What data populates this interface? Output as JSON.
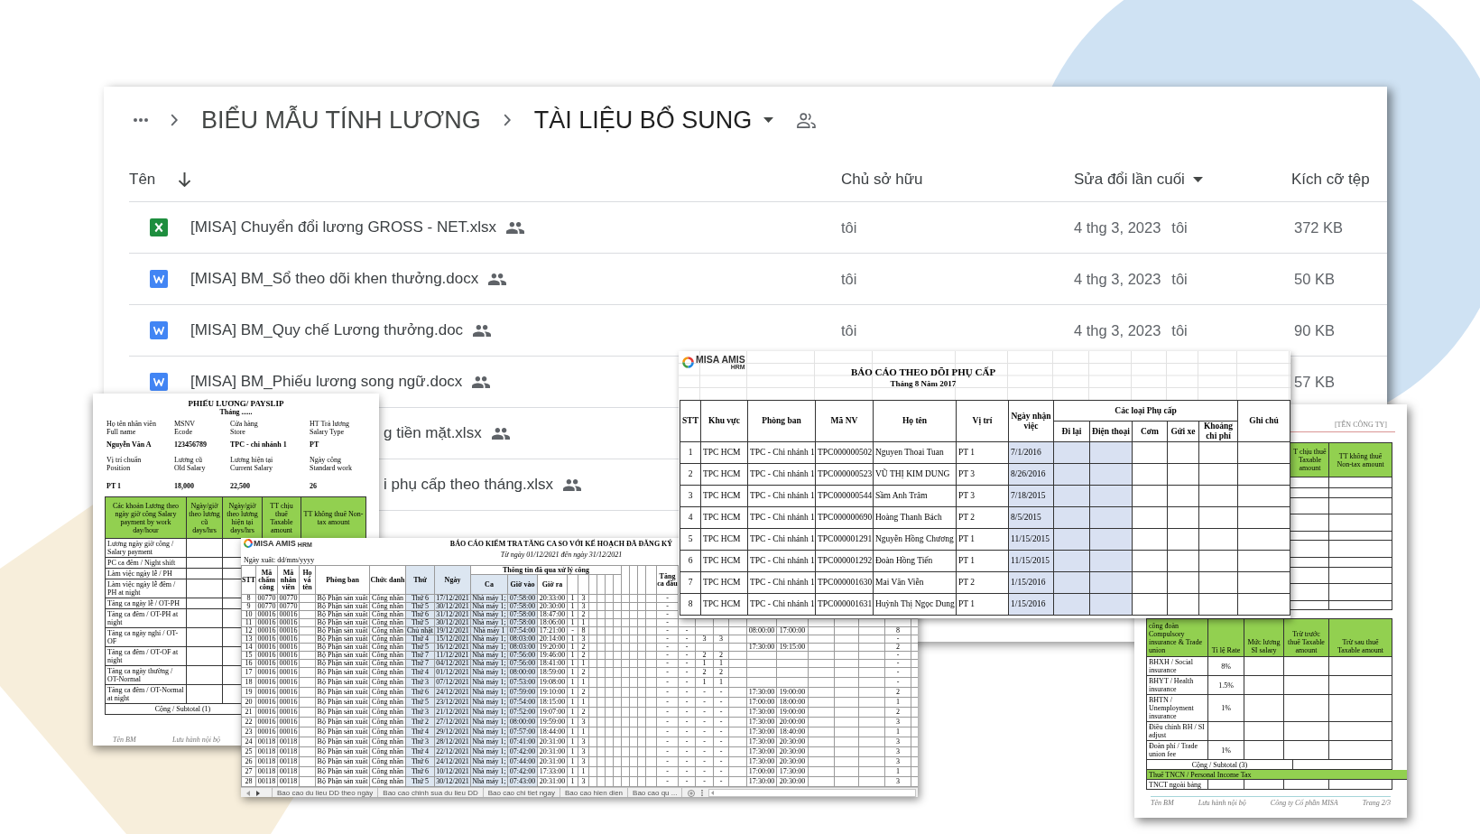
{
  "drive": {
    "breadcrumb": [
      {
        "label": "BIỂU MẪU TÍNH LƯƠNG",
        "current": false,
        "shared": false
      },
      {
        "label": "TÀI LIỆU BỔ SUNG",
        "current": true,
        "shared": true
      }
    ],
    "columns": [
      {
        "label": "Tên",
        "kind": "sorted"
      },
      {
        "label": "Chủ sở hữu",
        "kind": "plain"
      },
      {
        "label": "Sửa đổi lần cuối",
        "kind": "menu"
      },
      {
        "label": "Kích cỡ tệp",
        "kind": "plain"
      }
    ],
    "files": [
      {
        "kind": "spreadsheet",
        "name": "[MISA] Chuyển đổi lương GROSS - NET.xlsx",
        "shared": true,
        "owner": "tôi",
        "modified": "4 thg 3, 2023",
        "modified_by": "tôi",
        "size": "372 KB"
      },
      {
        "kind": "document",
        "name": "[MISA] BM_Sổ theo dõi khen thưởng.docx",
        "shared": true,
        "owner": "tôi",
        "modified": "4 thg 3, 2023",
        "modified_by": "tôi",
        "size": "50 KB"
      },
      {
        "kind": "document",
        "name": "[MISA] BM_Quy chế Lương thưởng.doc",
        "shared": true,
        "owner": "tôi",
        "modified": "4 thg 3, 2023",
        "modified_by": "tôi",
        "size": "90 KB"
      },
      {
        "kind": "document",
        "name": "[MISA] BM_Phiếu lương song ngữ.docx",
        "shared": true,
        "size": "57 KB"
      },
      {
        "kind": "covered",
        "name": "g tiền mặt.xlsx",
        "shared": true
      },
      {
        "kind": "covered",
        "name": "i phụ cấp theo tháng.xlsx",
        "shared": true
      }
    ]
  },
  "allowance_report": {
    "logo": "MISA AMIS",
    "logo_suffix": "HRM",
    "title": "BÁO CÁO THEO DÕI PHỤ CẤP",
    "subtitle": "Tháng 8 Năm 2017",
    "column_group": "Các loại Phụ cấp",
    "columns": [
      {
        "label": "STT",
        "grouped": false,
        "shaded": false
      },
      {
        "label": "Khu vực",
        "grouped": false,
        "shaded": false
      },
      {
        "label": "Phòng ban",
        "grouped": false,
        "shaded": false
      },
      {
        "label": "Mã NV",
        "grouped": false,
        "shaded": false
      },
      {
        "label": "Họ tên",
        "grouped": false,
        "shaded": false
      },
      {
        "label": "Vị trí",
        "grouped": false,
        "shaded": false
      },
      {
        "label": "Ngày nhận việc",
        "grouped": false,
        "shaded": true
      },
      {
        "label": "Đi lại",
        "grouped": true,
        "shaded": true
      },
      {
        "label": "Điện thoại",
        "grouped": true,
        "shaded": true
      },
      {
        "label": "Cơm",
        "grouped": true,
        "shaded": false
      },
      {
        "label": "Gửi xe",
        "grouped": true,
        "shaded": false
      },
      {
        "label": "Khoáng chi phí",
        "grouped": true,
        "shaded": false
      },
      {
        "label": "Ghi chú",
        "grouped": false,
        "shaded": false
      }
    ],
    "rows": [
      [
        "1",
        "TPC HCM",
        "TPC - Chi nhánh 1",
        "TPC000000502",
        "Nguyen Thoai Tuan",
        "PT 1",
        "7/1/2016"
      ],
      [
        "2",
        "TPC HCM",
        "TPC - Chi nhánh 1",
        "TPC000000523",
        "VŨ THỊ KIM DUNG",
        "PT 3",
        "8/26/2016"
      ],
      [
        "3",
        "TPC HCM",
        "TPC - Chi nhánh 1",
        "TPC000000544",
        "Sầm Anh Trâm",
        "PT 3",
        "7/18/2015"
      ],
      [
        "4",
        "TPC HCM",
        "TPC - Chi nhánh 1",
        "TPC000000690",
        "Hoàng Thanh Bách",
        "PT 2",
        "8/5/2015"
      ],
      [
        "5",
        "TPC HCM",
        "TPC - Chi nhánh 1",
        "TPC000001291",
        "Nguyễn Hồng Chương",
        "PT 1",
        "11/15/2015"
      ],
      [
        "6",
        "TPC HCM",
        "TPC - Chi nhánh 1",
        "TPC000001292",
        "Đoàn Hồng Tiến",
        "PT 1",
        "11/15/2015"
      ],
      [
        "7",
        "TPC HCM",
        "TPC - Chi nhánh 1",
        "TPC000001630",
        "Mai Văn Viễn",
        "PT 2",
        "1/15/2016"
      ],
      [
        "8",
        "TPC HCM",
        "TPC - Chi nhánh 1",
        "TPC000001631",
        "Huỳnh Thị Ngọc Dung",
        "PT 1",
        "1/15/2016"
      ]
    ]
  },
  "payslip": {
    "title": "PHIẾU LƯƠNG/ PAYSLIP",
    "period": "Tháng ......",
    "fields": [
      {
        "label": "Họ tên nhân viên",
        "label_en": "Full name",
        "value": "Nguyễn Văn A"
      },
      {
        "label": "MSNV",
        "label_en": "Ecode",
        "value": "123456789"
      },
      {
        "label": "Cửa hàng",
        "label_en": "Store",
        "value": "TPC - chi nhánh 1"
      },
      {
        "label": "HT Trả lương",
        "label_en": "Salary Type",
        "value": "PT"
      },
      {
        "label": "Vị trí chuẩn",
        "label_en": "Position",
        "value": "PT 1"
      },
      {
        "label": "Lương cũ",
        "label_en": "Old Salary",
        "value": "18,000"
      },
      {
        "label": "Lương hiện tại",
        "label_en": "Current Salary",
        "value": "22,500"
      },
      {
        "label": "Ngày công",
        "label_en": "Standard work",
        "value": "26"
      }
    ],
    "columns": [
      "Các khoản Lương theo ngày giờ công Salary payment by work day/hour",
      "Ngày/giờ theo lương cũ days/hrs",
      "Ngày/giờ theo lương hiện tại days/hrs",
      "TT chịu thuế Taxable amount",
      "TT không thuế Non-tax amount"
    ],
    "rows": [
      "Lương ngày giờ công / Salary payment",
      "PC ca đêm / Night shift",
      "Làm việc ngày lễ / PH",
      "Làm việc ngày lễ đêm / PH at night",
      "Tăng ca ngày lễ / OT-PH",
      "Tăng ca đêm / OT-PH at night",
      "Tăng ca ngày nghỉ / OT-OF",
      "Tăng ca đêm / OT-OF at night",
      "Tăng ca ngày thường / OT-Normal",
      "Tăng ca đêm / OT-Normal at night"
    ],
    "subtotal": "Cộng / Subtotal (1)",
    "footer": [
      "Tên BM",
      "Lưu hành nội bộ"
    ]
  },
  "overtime_report": {
    "logo": "MISA AMIS",
    "logo_suffix": "HRM",
    "title": "BÁO CÁO KIỂM TRA TĂNG CA SO VỚI KẾ HOẠCH ĐÃ ĐĂNG KÝ",
    "date_range": "Từ ngày 01/12/2021 đến ngày 31/12/2021",
    "export_date": "Ngày xuất: dd/mm/yyyy",
    "column_group": "Thông tin đã qua xử lý công",
    "columns": {
      "stt": {
        "label": "STT",
        "shaded": false
      },
      "attendance_code": {
        "label": "Mã chấm công",
        "shaded": false
      },
      "employee_code": {
        "label": "Mã nhân viên",
        "shaded": false
      },
      "full_name": {
        "label": "Họ và tên",
        "shaded": false
      },
      "department": {
        "label": "Phòng ban",
        "shaded": false
      },
      "job_title": {
        "label": "Chức danh",
        "shaded": false
      },
      "weekday": {
        "label": "Thứ",
        "shaded": true
      },
      "date": {
        "label": "Ngày",
        "shaded": true
      },
      "shift": {
        "label": "Ca",
        "shaded": true
      },
      "time_in": {
        "label": "Giờ vào",
        "shaded": true
      },
      "time_out": {
        "label": "Giờ ra",
        "shaded": false
      },
      "overtime_start": {
        "label": "Tăng ca đầu",
        "shaded": false
      }
    },
    "rows": [
      {
        "compact": true,
        "stt": "8",
        "attendance_code": "00770",
        "employee_code": "00770",
        "department": "Bộ Phận sản xuất",
        "job_title": "Công nhân",
        "weekday": "Thứ 6",
        "date": "17/12/2021",
        "shift": "Nhà máy 1;",
        "time_in": "07:58:00",
        "time_out": "20:33:00",
        "column_12": "1",
        "column_13": "3",
        "overtime_start": "-"
      },
      {
        "compact": true,
        "stt": "9",
        "attendance_code": "00770",
        "employee_code": "00770",
        "department": "Bộ Phận sản xuất",
        "job_title": "Công nhân",
        "weekday": "Thứ 5",
        "date": "30/12/2021",
        "shift": "Nhà máy 1;",
        "time_in": "07:58:00",
        "time_out": "20:30:00",
        "column_12": "1",
        "column_13": "3",
        "overtime_start": "-"
      },
      {
        "compact": true,
        "stt": "10",
        "attendance_code": "00016",
        "employee_code": "00016",
        "department": "Bộ Phận sản xuất",
        "job_title": "Công nhân",
        "weekday": "Thứ 6",
        "date": "31/12/2021",
        "shift": "Nhà máy 1;",
        "time_in": "07:58:00",
        "time_out": "18:47:00",
        "column_12": "1",
        "column_13": "2",
        "overtime_start": "-"
      },
      {
        "compact": true,
        "stt": "11",
        "attendance_code": "00016",
        "employee_code": "00016",
        "department": "Bộ Phận sản xuất",
        "job_title": "Công nhân",
        "weekday": "Thứ 5",
        "date": "30/12/2021",
        "shift": "Nhà máy 1;",
        "time_in": "07:58:00",
        "time_out": "18:06:00",
        "column_12": "1",
        "column_13": "1",
        "overtime_start": "-"
      },
      {
        "compact": true,
        "stt": "12",
        "attendance_code": "00016",
        "employee_code": "00016",
        "department": "Bộ Phận sản xuất",
        "job_title": "Công nhân",
        "weekday": "Chủ nhật",
        "date": "19/12/2021",
        "shift": "Nhà máy 1",
        "time_in": "07:54:00",
        "time_out": "17:21:00",
        "column_12": "-",
        "column_13": "8",
        "overtime_start": "-",
        "column_23": "-",
        "column_27": "08:00:00",
        "column_28": "17:00:00",
        "column_32": "8"
      },
      {
        "compact": true,
        "stt": "13",
        "attendance_code": "00016",
        "employee_code": "00016",
        "department": "Bộ Phận sản xuất",
        "job_title": "Công nhân",
        "weekday": "Thứ 4",
        "date": "15/12/2021",
        "shift": "Nhà máy 1;",
        "time_in": "08:03:00",
        "time_out": "20:14:00",
        "column_12": "1",
        "column_13": "3",
        "overtime_start": "-",
        "column_23": "-",
        "column_24": "3",
        "column_25": "3",
        "column_32": "-"
      },
      {
        "compact": true,
        "stt": "14",
        "attendance_code": "00016",
        "employee_code": "00016",
        "department": "Bộ Phận sản xuất",
        "job_title": "Công nhân",
        "weekday": "Thứ 5",
        "date": "16/12/2021",
        "shift": "Nhà máy 1;",
        "time_in": "08:03:00",
        "time_out": "19:20:00",
        "column_12": "1",
        "column_13": "2",
        "overtime_start": "-",
        "column_23": "-",
        "column_27": "17:30:00",
        "column_28": "19:15:00",
        "column_32": "2"
      },
      {
        "compact": true,
        "stt": "15",
        "attendance_code": "00016",
        "employee_code": "00016",
        "department": "Bộ Phận sản xuất",
        "job_title": "Công nhân",
        "weekday": "Thứ 7",
        "date": "11/12/2021",
        "shift": "Nhà máy 1;",
        "time_in": "07:56:00",
        "time_out": "19:46:00",
        "column_12": "1",
        "column_13": "2",
        "overtime_start": "-",
        "column_23": "-",
        "column_24": "2",
        "column_25": "2",
        "column_32": "-"
      },
      {
        "compact": true,
        "stt": "16",
        "attendance_code": "00016",
        "employee_code": "00016",
        "department": "Bộ Phận sản xuất",
        "job_title": "Công nhân",
        "weekday": "Thứ 7",
        "date": "04/12/2021",
        "shift": "Nhà máy 1;",
        "time_in": "07:56:00",
        "time_out": "18:41:00",
        "column_12": "1",
        "column_13": "1",
        "overtime_start": "-",
        "column_23": "-",
        "column_24": "1",
        "column_25": "1",
        "column_32": "-"
      },
      {
        "compact": false,
        "stt": "17",
        "attendance_code": "00016",
        "employee_code": "00016",
        "department": "Bộ Phận sản xuất",
        "job_title": "Công nhân",
        "weekday": "Thứ 4",
        "date": "01/12/2021",
        "shift": "Nhà máy 1;",
        "time_in": "08:00:00",
        "time_out": "18:59:00",
        "column_12": "1",
        "column_13": "2",
        "overtime_start": "-",
        "column_23": "-",
        "column_24": "2",
        "column_25": "2",
        "column_32": "-"
      },
      {
        "compact": false,
        "stt": "18",
        "attendance_code": "00016",
        "employee_code": "00016",
        "department": "Bộ Phận sản xuất",
        "job_title": "Công nhân",
        "weekday": "Thứ 3",
        "date": "07/12/2021",
        "shift": "Nhà máy 1;",
        "time_in": "07:53:00",
        "time_out": "19:08:00",
        "column_12": "1",
        "column_13": "1",
        "overtime_start": "-",
        "column_23": "-",
        "column_24": "1",
        "column_25": "1",
        "column_32": "-"
      },
      {
        "compact": false,
        "stt": "19",
        "attendance_code": "00016",
        "employee_code": "00016",
        "department": "Bộ Phận sản xuất",
        "job_title": "Công nhân",
        "weekday": "Thứ 6",
        "date": "24/12/2021",
        "shift": "Nhà máy 1;",
        "time_in": "07:59:00",
        "time_out": "19:10:00",
        "column_12": "1",
        "column_13": "2",
        "overtime_start": "-",
        "column_23": "-",
        "column_24": "-",
        "column_25": "-",
        "column_27": "17:30:00",
        "column_28": "19:00:00",
        "column_32": "2"
      },
      {
        "compact": false,
        "stt": "20",
        "attendance_code": "00016",
        "employee_code": "00016",
        "department": "Bộ Phận sản xuất",
        "job_title": "Công nhân",
        "weekday": "Thứ 5",
        "date": "23/12/2021",
        "shift": "Nhà máy 1;",
        "time_in": "07:54:00",
        "time_out": "18:15:00",
        "column_12": "1",
        "column_13": "1",
        "overtime_start": "-",
        "column_23": "-",
        "column_24": "-",
        "column_25": "-",
        "column_27": "17:00:00",
        "column_28": "18:00:00",
        "column_32": "1"
      },
      {
        "compact": false,
        "stt": "21",
        "attendance_code": "00016",
        "employee_code": "00016",
        "department": "Bộ Phận sản xuất",
        "job_title": "Công nhân",
        "weekday": "Thứ 3",
        "date": "21/12/2021",
        "shift": "Nhà máy 1;",
        "time_in": "07:52:00",
        "time_out": "19:07:00",
        "column_12": "1",
        "column_13": "2",
        "overtime_start": "-",
        "column_23": "-",
        "column_24": "-",
        "column_25": "-",
        "column_27": "17:30:00",
        "column_28": "19:00:00",
        "column_32": "2"
      },
      {
        "compact": false,
        "stt": "22",
        "attendance_code": "00016",
        "employee_code": "00016",
        "department": "Bộ Phận sản xuất",
        "job_title": "Công nhân",
        "weekday": "Thứ 2",
        "date": "27/12/2021",
        "shift": "Nhà máy 1;",
        "time_in": "08:00:00",
        "time_out": "19:59:00",
        "column_12": "1",
        "column_13": "3",
        "overtime_start": "-",
        "column_23": "-",
        "column_24": "-",
        "column_25": "-",
        "column_27": "17:30:00",
        "column_28": "20:00:00",
        "column_32": "3"
      },
      {
        "compact": false,
        "stt": "23",
        "attendance_code": "00016",
        "employee_code": "00016",
        "department": "Bộ Phận sản xuất",
        "job_title": "Công nhân",
        "weekday": "Thứ 4",
        "date": "29/12/2021",
        "shift": "Nhà máy 1;",
        "time_in": "07:57:00",
        "time_out": "18:44:00",
        "column_12": "1",
        "column_13": "1",
        "overtime_start": "-",
        "column_23": "-",
        "column_24": "-",
        "column_25": "-",
        "column_27": "17:30:00",
        "column_28": "18:40:00",
        "column_32": "1"
      },
      {
        "compact": false,
        "stt": "24",
        "attendance_code": "00118",
        "employee_code": "00118",
        "department": "Bộ Phận sản xuất",
        "job_title": "Công nhân",
        "weekday": "Thứ 3",
        "date": "28/12/2021",
        "shift": "Nhà máy 1;",
        "time_in": "07:41:00",
        "time_out": "20:31:00",
        "column_12": "1",
        "column_13": "3",
        "overtime_start": "-",
        "column_23": "-",
        "column_24": "-",
        "column_25": "-",
        "column_27": "17:30:00",
        "column_28": "20:30:00",
        "column_32": "3"
      },
      {
        "compact": false,
        "stt": "25",
        "attendance_code": "00118",
        "employee_code": "00118",
        "department": "Bộ Phận sản xuất",
        "job_title": "Công nhân",
        "weekday": "Thứ 4",
        "date": "22/12/2021",
        "shift": "Nhà máy 1;",
        "time_in": "07:42:00",
        "time_out": "20:31:00",
        "column_12": "1",
        "column_13": "3",
        "overtime_start": "-",
        "column_23": "-",
        "column_24": "-",
        "column_25": "-",
        "column_27": "17:30:00",
        "column_28": "20:30:00",
        "column_32": "3"
      },
      {
        "compact": false,
        "stt": "26",
        "attendance_code": "00118",
        "employee_code": "00118",
        "department": "Bộ Phận sản xuất",
        "job_title": "Công nhân",
        "weekday": "Thứ 6",
        "date": "24/12/2021",
        "shift": "Nhà máy 1;",
        "time_in": "07:44:00",
        "time_out": "20:31:00",
        "column_12": "1",
        "column_13": "3",
        "overtime_start": "-",
        "column_23": "-",
        "column_24": "-",
        "column_25": "-",
        "column_27": "17:30:00",
        "column_28": "20:30:00",
        "column_32": "3"
      },
      {
        "compact": false,
        "stt": "27",
        "attendance_code": "00118",
        "employee_code": "00118",
        "department": "Bộ Phận sản xuất",
        "job_title": "Công nhân",
        "weekday": "Thứ 6",
        "date": "10/12/2021",
        "shift": "Nhà máy 1;",
        "time_in": "07:42:00",
        "time_out": "17:33:00",
        "column_12": "1",
        "column_13": "1",
        "overtime_start": "-",
        "column_23": "-",
        "column_24": "-",
        "column_25": "-",
        "column_27": "17:00:00",
        "column_28": "17:30:00",
        "column_32": "1"
      },
      {
        "compact": false,
        "stt": "28",
        "attendance_code": "00118",
        "employee_code": "00118",
        "department": "Bộ Phận sản xuất",
        "job_title": "Công nhân",
        "weekday": "Thứ 5",
        "date": "30/12/2021",
        "shift": "Nhà máy 1;",
        "time_in": "07:43:00",
        "time_out": "20:31:00",
        "column_12": "1",
        "column_13": "3",
        "overtime_start": "-",
        "column_23": "-",
        "column_24": "-",
        "column_25": "-",
        "column_27": "17:30:00",
        "column_28": "20:30:00",
        "column_32": "3"
      }
    ],
    "tabs": [
      {
        "label": "Bao cao du lieu DD theo ngày",
        "selected": false
      },
      {
        "label": "Bao cao chinh sua du lieu DD",
        "selected": false
      },
      {
        "label": "Bao cao chi tiet ngay",
        "selected": false
      },
      {
        "label": "Bao cao hien dien",
        "selected": false
      },
      {
        "label": "Bao cao qu ...",
        "selected": false
      }
    ]
  },
  "payslip_page2": {
    "company": "[TÊN CÔNG TY]",
    "earnings_columns": [
      "T chịu thuế Taxable amount",
      "TT không thuế Non-tax amount"
    ],
    "insurance_columns": [
      "công đoàn Compulsory insurance & Trade union",
      "Tỉ lệ Rate",
      "Mức lương SI salary",
      "Trừ trước thuế Taxable amount",
      "Trừ sau thuế Taxable amount"
    ],
    "insurance_rows": [
      {
        "label": "BHXH / Social insurance",
        "rate": "8%"
      },
      {
        "label": "BHYT / Health insurance",
        "rate": "1.5%"
      },
      {
        "label": "BHTN / Unemployment insurance",
        "rate": "1%"
      },
      {
        "label": "Điều chỉnh BH / SI adjust"
      },
      {
        "label": "Đoàn phí / Trade union fee",
        "rate": "1%"
      }
    ],
    "subtotal": "Cộng / Subtotal (3)",
    "tax_section": "Thuế TNCN / Personal Income Tax",
    "tax_row": "TNCT ngoài bảng",
    "footer": [
      "Tên BM",
      "Lưu hành nội bộ",
      "Công ty Cổ phần MISA",
      "Trang 2/3"
    ]
  }
}
